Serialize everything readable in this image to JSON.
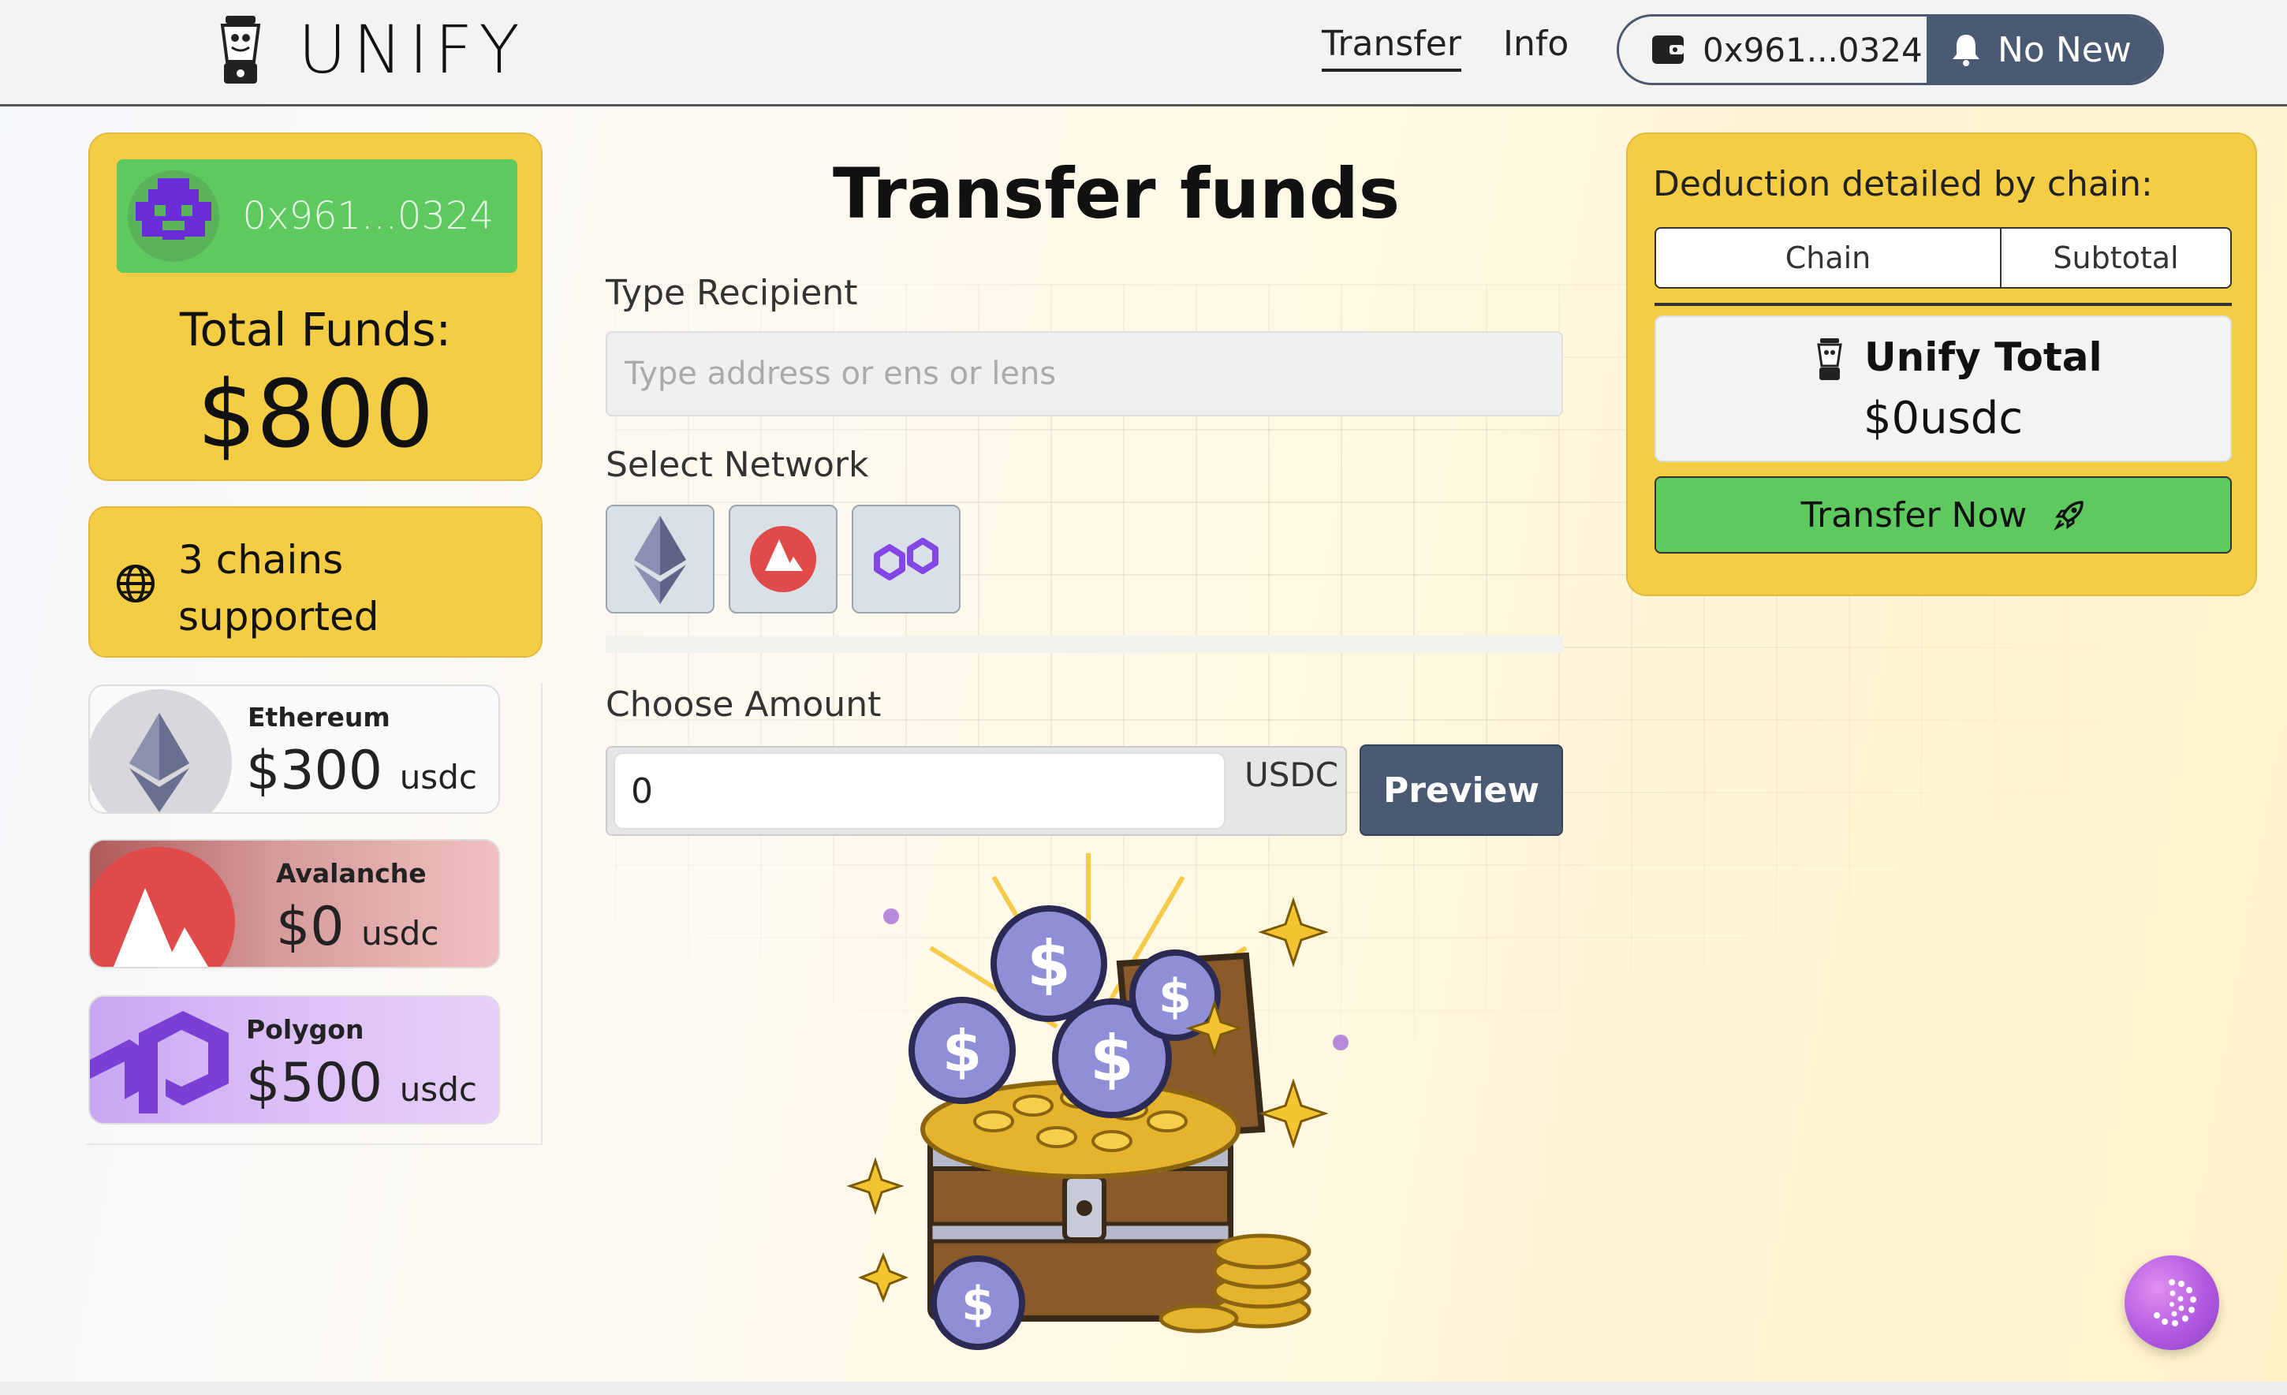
{
  "header": {
    "brand": "UNIFY",
    "nav": {
      "transfer": "Transfer",
      "info": "Info"
    },
    "wallet_address": "0x961...0324",
    "notifications": "No New"
  },
  "profile": {
    "address": "0x961...0324",
    "total_funds_label": "Total Funds:",
    "total_funds_value": "$800"
  },
  "chains_summary": {
    "line1": "3 chains",
    "line2": "supported"
  },
  "chain_balances": [
    {
      "name": "Ethereum",
      "amount": "$300",
      "unit": "usdc"
    },
    {
      "name": "Avalanche",
      "amount": "$0",
      "unit": "usdc"
    },
    {
      "name": "Polygon",
      "amount": "$500",
      "unit": "usdc"
    }
  ],
  "form": {
    "title": "Transfer funds",
    "recipient_label": "Type Recipient",
    "recipient_placeholder": "Type address or ens or lens",
    "network_label": "Select Network",
    "networks": [
      "ethereum",
      "avalanche",
      "polygon"
    ],
    "amount_label": "Choose Amount",
    "amount_value": "0",
    "amount_unit": "USDC",
    "preview_label": "Preview"
  },
  "deduction": {
    "title": "Deduction detailed by chain:",
    "columns": [
      "Chain",
      "Subtotal"
    ],
    "total_label": "Unify Total",
    "total_value": "$0usdc",
    "transfer_button": "Transfer Now"
  },
  "colors": {
    "card_yellow": "#f5cd45",
    "accent_green": "#5ec95e",
    "slate": "#4a5a72"
  }
}
